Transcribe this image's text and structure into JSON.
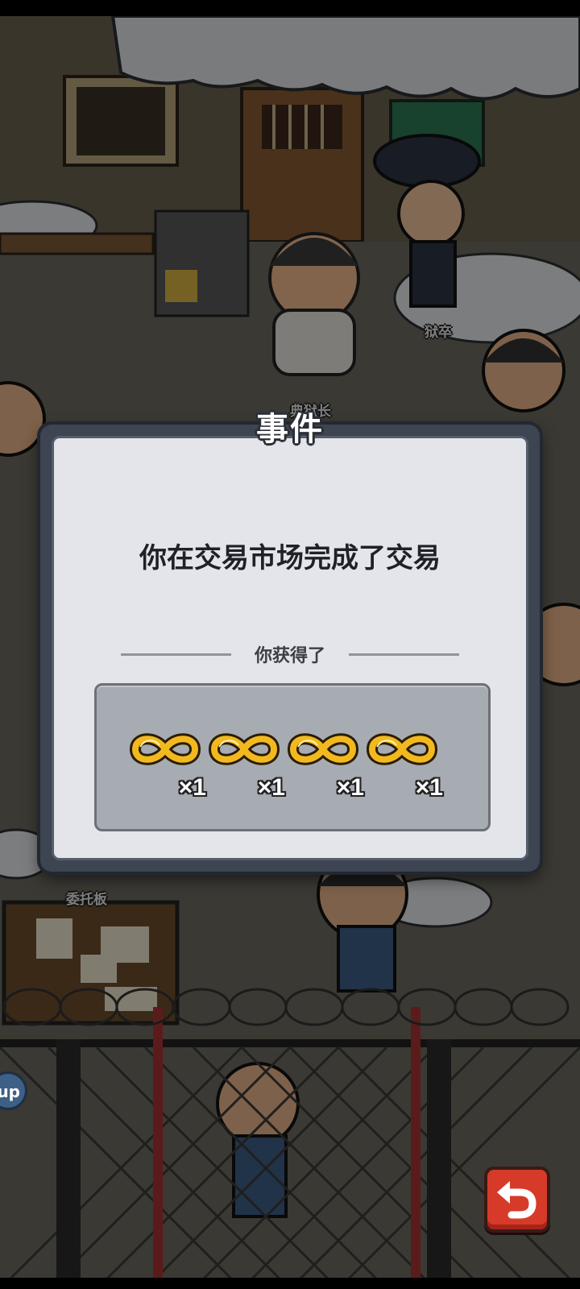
{
  "npc_labels": {
    "warden": "典狱长",
    "guard": "狱卒",
    "board": "委托板"
  },
  "dialog": {
    "title": "事件",
    "message": "你在交易市场完成了交易",
    "rewards_caption": "你获得了",
    "rewards": [
      {
        "icon": "gold-infinity-ring-icon",
        "count": "×1"
      },
      {
        "icon": "gold-infinity-ring-icon",
        "count": "×1"
      },
      {
        "icon": "gold-infinity-ring-icon",
        "count": "×1"
      },
      {
        "icon": "gold-infinity-ring-icon",
        "count": "×1"
      }
    ]
  },
  "side_button": {
    "label": "up"
  },
  "colors": {
    "dialog_panel": "#e3e5ea",
    "dialog_frame": "#3d4452",
    "reward_box": "#a7abb2",
    "back_button": "#d63b2a",
    "ring_gold": "#f2b91f"
  }
}
